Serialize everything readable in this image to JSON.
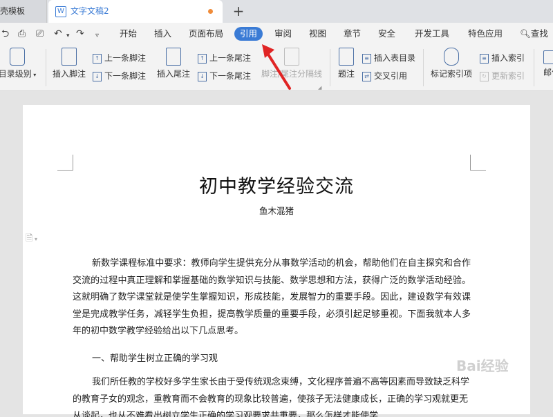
{
  "tabs": {
    "prev_label": "壳模板",
    "active_label": "文字文稿2",
    "active_icon": "W",
    "add_label": "+"
  },
  "menu": {
    "items": [
      "开始",
      "插入",
      "页面布局",
      "引用",
      "审阅",
      "视图",
      "章节",
      "安全",
      "开发工具",
      "特色应用"
    ],
    "search_label": "查找"
  },
  "ribbon": {
    "toc_level": "目录级别",
    "insert_footnote": "插入脚注",
    "prev_footnote": "上一条脚注",
    "next_footnote": "下一条脚注",
    "insert_endnote": "插入尾注",
    "prev_endnote": "上一条尾注",
    "next_endnote": "下一条尾注",
    "footnote_endnote_separator": "脚注/尾注分隔线",
    "caption": "题注",
    "insert_table_of_figures": "插入表目录",
    "cross_reference": "交叉引用",
    "mark_index_entry": "标记索引项",
    "insert_index": "插入索引",
    "update_index": "更新索引",
    "mail": "邮件"
  },
  "document": {
    "title": "初中教学经验交流",
    "author": "鱼木混猪",
    "paragraph1": "新数学课程标准中要求：教师向学生提供充分从事数学活动的机会，帮助他们在自主探究和合作交流的过程中真正理解和掌握基础的数学知识与技能、数学思想和方法，获得广泛的数学活动经验。这就明确了数学课堂就是使学生掌握知识，形成技能，发展智力的重要手段。因此，建设数学有效课堂是完成教学任务，减轻学生负担，提高教学质量的重要手段，必须引起足够重视。下面我就本人多年的初中数学教学经验给出以下几点思考。",
    "heading1": "一、帮助学生树立正确的学习观",
    "paragraph2": "我们所任教的学校好多学生家长由于受传统观念束缚，文化程序普遍不高等因素而导致缺乏科学的教育子女的观念，重教育而不会教育的现象比较普遍，使孩子无法健康成长，正确的学习观就更无从谈起，也从不难看出树立学生正确的学习观要求共重要，那么怎样才能使学"
  },
  "watermark": "Bai经验"
}
